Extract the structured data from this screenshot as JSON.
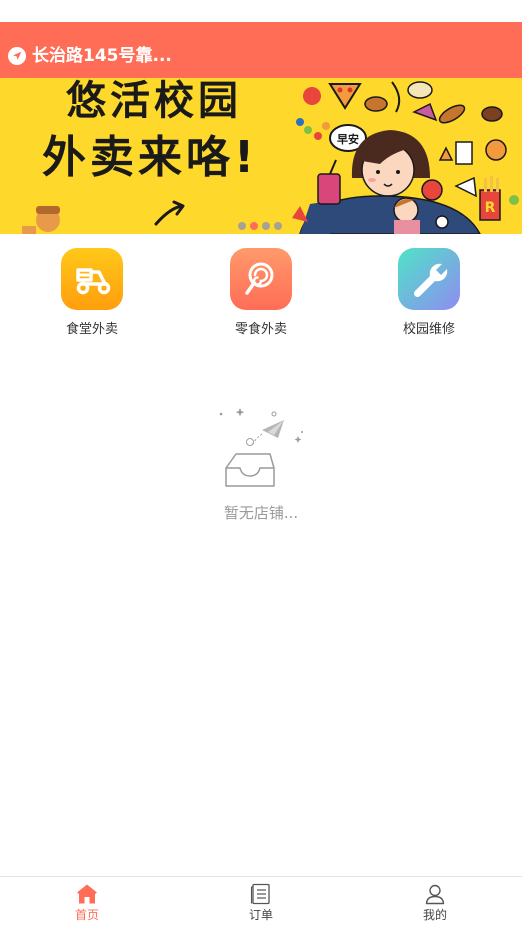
{
  "header": {
    "location_text": "长治路145号靠..."
  },
  "banner": {
    "line1": "悠活校园",
    "line2": "外卖来咯!",
    "sign_text": "早安",
    "carousel_pages": 4,
    "active_page": 2
  },
  "categories": [
    {
      "label": "食堂外卖",
      "icon": "scooter-icon"
    },
    {
      "label": "零食外卖",
      "icon": "lollipop-icon"
    },
    {
      "label": "校园维修",
      "icon": "wrench-icon"
    }
  ],
  "empty_state": {
    "text": "暂无店铺..."
  },
  "tabbar": {
    "items": [
      {
        "label": "首页",
        "icon": "home-icon",
        "active": true
      },
      {
        "label": "订单",
        "icon": "orders-icon",
        "active": false
      },
      {
        "label": "我的",
        "icon": "profile-icon",
        "active": false
      }
    ]
  },
  "colors": {
    "accent": "#FF6D57",
    "banner_bg": "#FFD82C"
  }
}
